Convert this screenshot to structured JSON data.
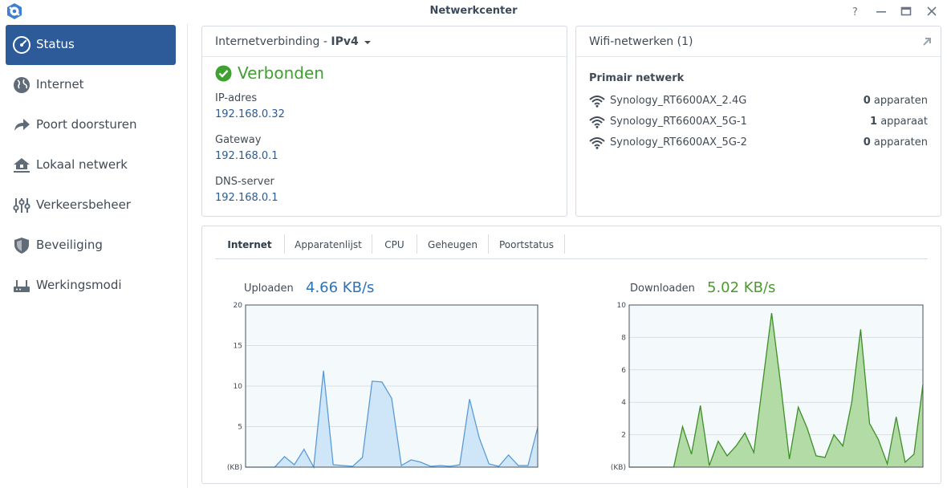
{
  "window": {
    "title": "Netwerkcenter",
    "buttons": [
      "help",
      "minimize",
      "maximize",
      "close"
    ]
  },
  "sidebar": {
    "items": [
      {
        "label": "Status",
        "icon": "speedometer-icon",
        "active": true
      },
      {
        "label": "Internet",
        "icon": "globe-icon",
        "active": false
      },
      {
        "label": "Poort doorsturen",
        "icon": "forward-arrow-icon",
        "active": false
      },
      {
        "label": "Lokaal netwerk",
        "icon": "home-network-icon",
        "active": false
      },
      {
        "label": "Verkeersbeheer",
        "icon": "sliders-icon",
        "active": false
      },
      {
        "label": "Beveiliging",
        "icon": "shield-icon",
        "active": false
      },
      {
        "label": "Werkingsmodi",
        "icon": "router-icon",
        "active": false
      }
    ]
  },
  "internet_panel": {
    "title": "Internetverbinding -",
    "protocol": "IPv4",
    "status": "Verbonden",
    "fields": [
      {
        "label": "IP-adres",
        "value": "192.168.0.32"
      },
      {
        "label": "Gateway",
        "value": "192.168.0.1"
      },
      {
        "label": "DNS-server",
        "value": "192.168.0.1"
      }
    ]
  },
  "wifi_panel": {
    "title": "Wifi-netwerken (1)",
    "subtitle": "Primair netwerk",
    "networks": [
      {
        "name": "Synology_RT6600AX_2.4G",
        "count": "0",
        "unit": "apparaten"
      },
      {
        "name": "Synology_RT6600AX_5G-1",
        "count": "1",
        "unit": "apparaat"
      },
      {
        "name": "Synology_RT6600AX_5G-2",
        "count": "0",
        "unit": "apparaten"
      }
    ]
  },
  "tabs": [
    {
      "label": "Internet",
      "active": true
    },
    {
      "label": "Apparatenlijst",
      "active": false
    },
    {
      "label": "CPU",
      "active": false
    },
    {
      "label": "Geheugen",
      "active": false
    },
    {
      "label": "Poortstatus",
      "active": false
    }
  ],
  "upload": {
    "label": "Uploaden",
    "value": "4.66 KB/s",
    "color": "#2d72b8"
  },
  "download": {
    "label": "Downloaden",
    "value": "5.02 KB/s",
    "color": "#4a9a2e"
  },
  "colors": {
    "accent": "#2d5b99",
    "success": "#3ea130",
    "upload_line": "#5b9bd5",
    "upload_fill": "#cfe6f9",
    "download_line": "#3d8f27",
    "download_fill": "#b3dba6",
    "chart_bg": "#f4f9fc"
  },
  "chart_data": [
    {
      "type": "area",
      "unit": "(KB)",
      "ylim": [
        0,
        20
      ],
      "yticks": [
        5,
        10,
        15,
        20
      ],
      "x": [
        0,
        1,
        2,
        3,
        4,
        5,
        6,
        7,
        8,
        9,
        10,
        11,
        12,
        13,
        14,
        15,
        16,
        17,
        18,
        19,
        20,
        21,
        22,
        23,
        24,
        25,
        26,
        27,
        28,
        29
      ],
      "values": [
        0,
        0,
        0,
        0,
        1.3,
        0.3,
        2.2,
        0,
        11.9,
        0.3,
        0.2,
        0.1,
        1.2,
        10.6,
        10.5,
        8.5,
        0.2,
        0.9,
        0.6,
        0.1,
        0.2,
        0.1,
        0.3,
        8.4,
        3.6,
        0.4,
        0.1,
        1.5,
        0.2,
        0.2,
        4.9
      ]
    },
    {
      "type": "area",
      "unit": "(KB)",
      "ylim": [
        0,
        10
      ],
      "yticks": [
        2,
        4,
        6,
        8,
        10
      ],
      "values": [
        0,
        0,
        0,
        0,
        0,
        0,
        2.5,
        0.8,
        3.8,
        0.1,
        1.6,
        0.7,
        1.3,
        2.1,
        0.9,
        5.2,
        9.5,
        5.2,
        0.5,
        3.7,
        2.4,
        0.7,
        0.6,
        2.0,
        1.3,
        4.0,
        8.5,
        2.7,
        1.7,
        0.2,
        3.1,
        0.3,
        0.8,
        5.1
      ]
    }
  ]
}
